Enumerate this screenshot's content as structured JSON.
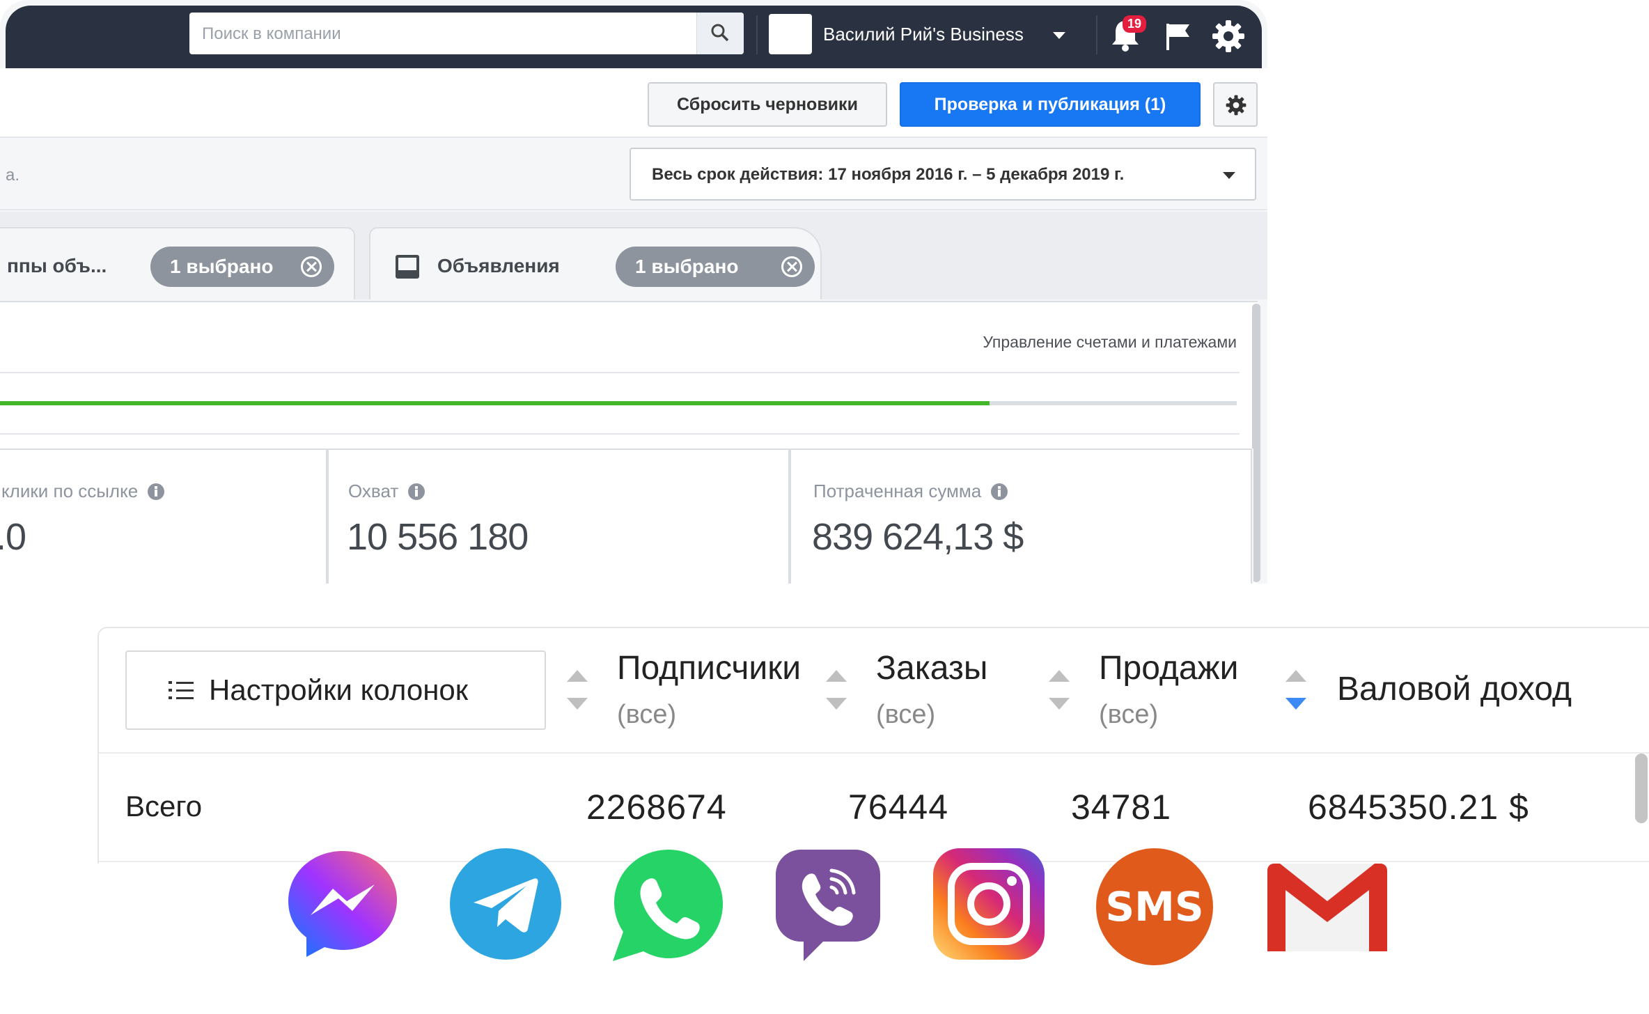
{
  "topbar": {
    "search_placeholder": "Поиск в компании",
    "business_name": "Василий Рий's Business",
    "notification_count": "19"
  },
  "toolbar": {
    "reset_drafts": "Сбросить черновики",
    "review_publish": "Проверка и публикация (1)"
  },
  "date_row": {
    "left_fragment": "a.",
    "range": "Весь срок действия: 17 ноября 2016 г. – 5 декабря 2019 г."
  },
  "tabs": [
    {
      "label": "ппы объ...",
      "chip": "1 выбрано"
    },
    {
      "label": "Объявления",
      "chip": "1 выбрано"
    }
  ],
  "billing_link": "Управление счетами и платежами",
  "progress_fraction": 0.8,
  "metrics": [
    {
      "label": "клики по ссылке",
      "value": ".0"
    },
    {
      "label": "Охват",
      "value": "10 556 180"
    },
    {
      "label": "Потраченная сумма",
      "value": "839 624,13 $"
    }
  ],
  "table": {
    "column_settings": "Настройки колонок",
    "columns": [
      {
        "title": "Подписчики",
        "subtitle": "(все)"
      },
      {
        "title": "Заказы",
        "subtitle": "(все)"
      },
      {
        "title": "Продажи",
        "subtitle": "(все)"
      },
      {
        "title": "Валовой доход",
        "subtitle": ""
      }
    ],
    "total_row": {
      "label": "Всего",
      "values": [
        "2268674",
        "76444",
        "34781",
        "6845350.21 $"
      ]
    }
  },
  "messenger_icons": [
    {
      "icon": "facebook-messenger-icon",
      "color": "#a033ff"
    },
    {
      "icon": "telegram-icon",
      "color": "#2ca5e0"
    },
    {
      "icon": "whatsapp-icon",
      "color": "#25d366"
    },
    {
      "icon": "viber-icon",
      "color": "#7b519d"
    },
    {
      "icon": "instagram-icon",
      "color": "#e1306c"
    },
    {
      "icon": "sms-icon",
      "label": "SMS",
      "color": "#e05a1c"
    },
    {
      "icon": "gmail-icon",
      "color": "#d93025"
    }
  ]
}
